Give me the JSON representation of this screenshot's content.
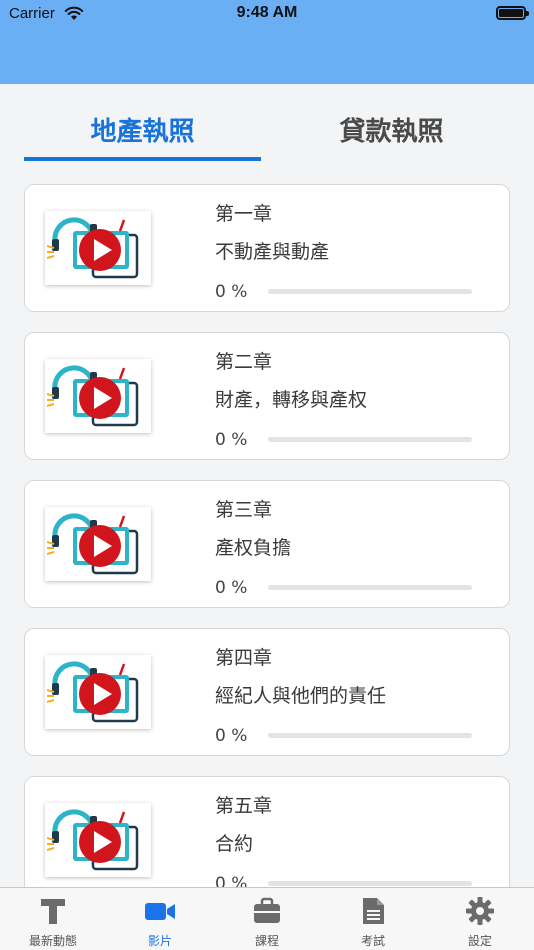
{
  "status_bar": {
    "carrier": "Carrier",
    "time": "9:48 AM"
  },
  "tabs": [
    {
      "label": "地產執照",
      "active": true
    },
    {
      "label": "貸款執照",
      "active": false
    }
  ],
  "chapters": [
    {
      "title": "第一章",
      "subtitle": "不動產與動產",
      "progress_label": "0 %",
      "progress": 0
    },
    {
      "title": "第二章",
      "subtitle": "財產，轉移與產权",
      "progress_label": "0 %",
      "progress": 0
    },
    {
      "title": "第三章",
      "subtitle": "產权負擔",
      "progress_label": "0 %",
      "progress": 0
    },
    {
      "title": "第四章",
      "subtitle": "經紀人與他們的責任",
      "progress_label": "0 %",
      "progress": 0
    },
    {
      "title": "第五章",
      "subtitle": "合約",
      "progress_label": "0 %",
      "progress": 0
    }
  ],
  "tabbar": [
    {
      "label": "最新動態",
      "icon": "text-t-icon",
      "active": false
    },
    {
      "label": "影片",
      "icon": "video-camera-icon",
      "active": true
    },
    {
      "label": "課程",
      "icon": "briefcase-icon",
      "active": false
    },
    {
      "label": "考試",
      "icon": "document-icon",
      "active": false
    },
    {
      "label": "設定",
      "icon": "gear-icon",
      "active": false
    }
  ],
  "colors": {
    "header": "#6aaef3",
    "accent": "#1a73d9",
    "background": "#f2f4f6",
    "play_button": "#d0161c",
    "tab_active_icon": "#1a73e8",
    "tab_inactive_icon": "#6b6b6b"
  }
}
